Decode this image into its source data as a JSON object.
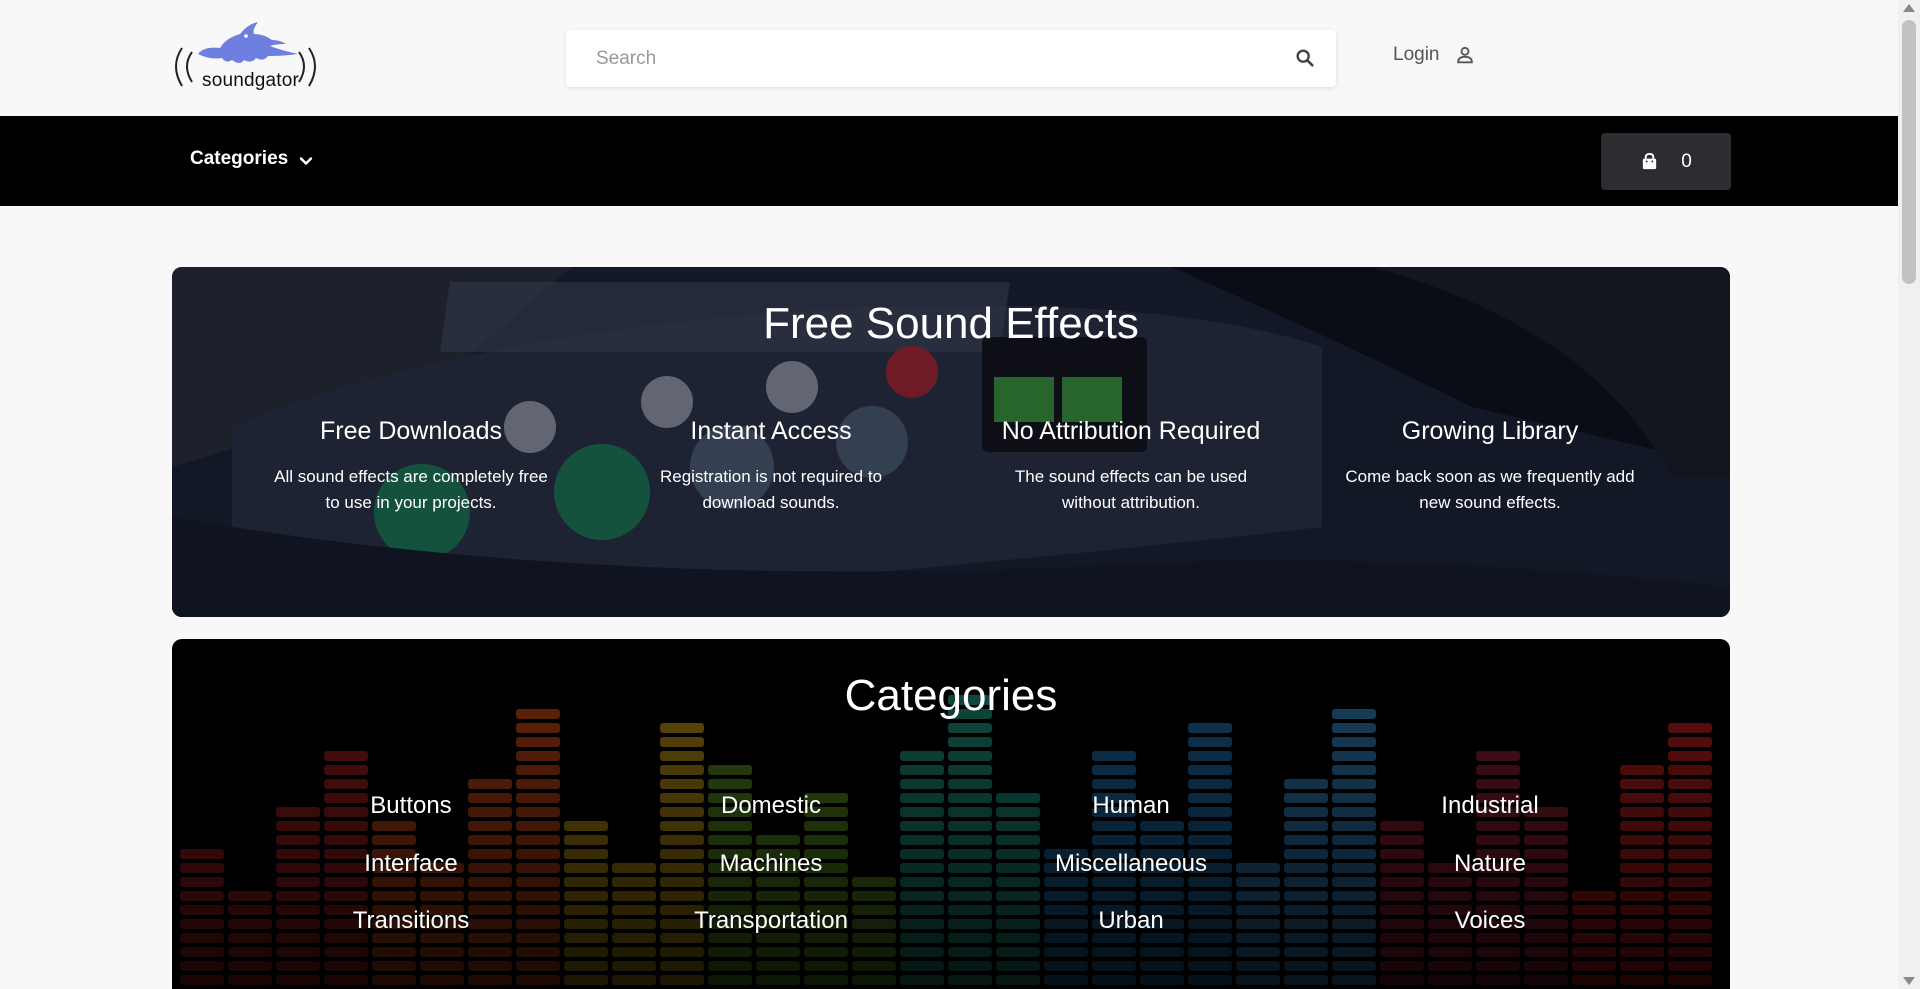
{
  "header": {
    "logo_text": "soundgator",
    "search_placeholder": "Search",
    "login_label": "Login"
  },
  "navbar": {
    "categories_label": "Categories",
    "cart_count": "0"
  },
  "hero": {
    "title": "Free Sound Effects",
    "features": [
      {
        "title": "Free Downloads",
        "line1": "All sound effects are completely free",
        "line2": "to use in your projects."
      },
      {
        "title": "Instant Access",
        "line1": "Registration is not required to",
        "line2": "download sounds."
      },
      {
        "title": "No Attribution Required",
        "line1": "The sound effects can be used",
        "line2": "without attribution."
      },
      {
        "title": "Growing Library",
        "line1": "Come back soon as we frequently add",
        "line2": "new sound effects."
      }
    ]
  },
  "categories": {
    "title": "Categories",
    "items": [
      "Buttons",
      "Domestic",
      "Human",
      "Industrial",
      "Interface",
      "Machines",
      "Miscellaneous",
      "Nature",
      "Transitions",
      "Transportation",
      "Urban",
      "Voices"
    ]
  },
  "colors": {
    "logo_blue": "#6f7fe0",
    "navbar_bg": "#000000",
    "cart_bg": "#2b2d31"
  }
}
